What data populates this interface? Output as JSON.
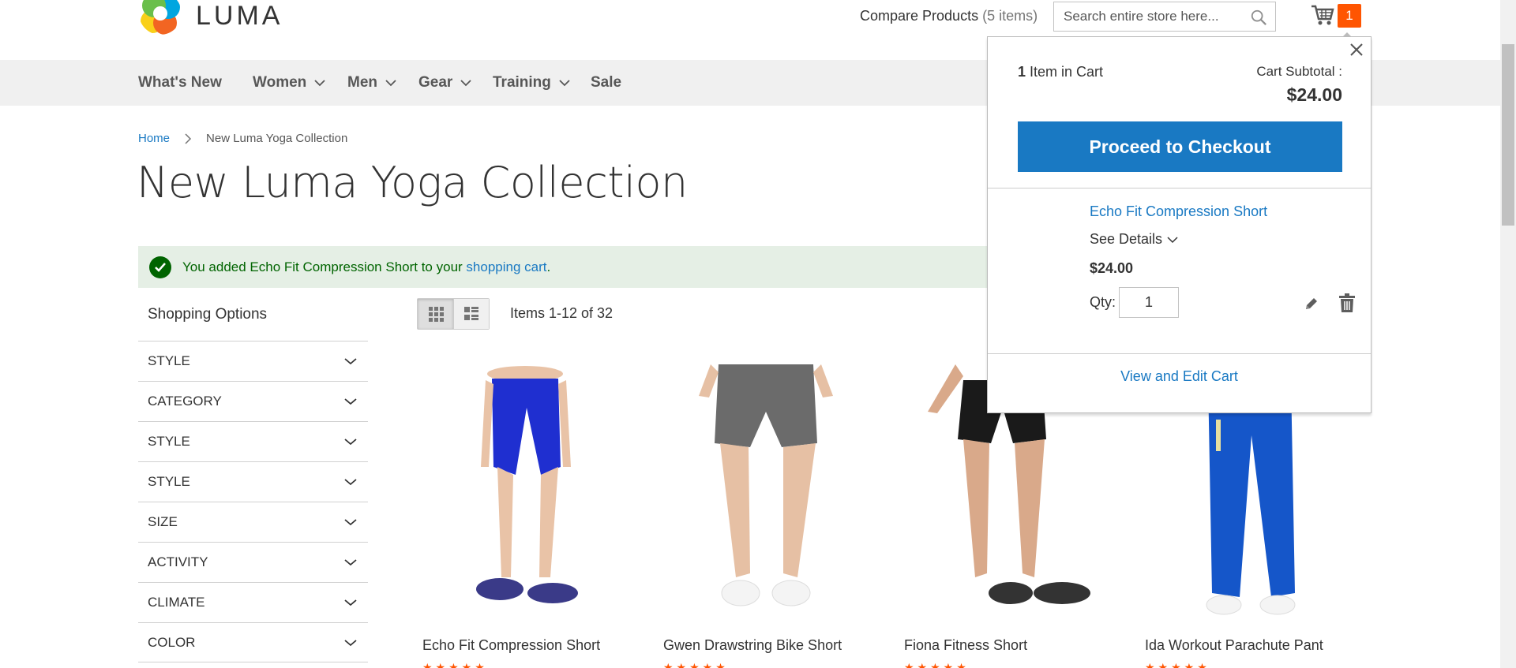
{
  "header": {
    "logo_text": "LUMA",
    "compare_label": "Compare Products",
    "compare_count": "(5 items)",
    "search_placeholder": "Search entire store here...",
    "cart_count": "1"
  },
  "nav": {
    "items": [
      {
        "label": "What's New",
        "has_dropdown": false
      },
      {
        "label": "Women",
        "has_dropdown": true
      },
      {
        "label": "Men",
        "has_dropdown": true
      },
      {
        "label": "Gear",
        "has_dropdown": true
      },
      {
        "label": "Training",
        "has_dropdown": true
      },
      {
        "label": "Sale",
        "has_dropdown": false
      }
    ]
  },
  "breadcrumb": {
    "home": "Home",
    "current": "New Luma Yoga Collection"
  },
  "page_title": "New Luma Yoga Collection",
  "message": {
    "prefix": "You added Echo Fit Compression Short to your ",
    "link": "shopping cart",
    "suffix": "."
  },
  "sidebar": {
    "title": "Shopping Options",
    "filters": [
      "STYLE",
      "CATEGORY",
      "STYLE",
      "STYLE",
      "SIZE",
      "ACTIVITY",
      "CLIMATE",
      "COLOR"
    ]
  },
  "toolbar": {
    "items_count": "Items 1-12 of 32"
  },
  "products": [
    {
      "name": "Echo Fit Compression Short"
    },
    {
      "name": "Gwen Drawstring Bike Short"
    },
    {
      "name": "Fiona Fitness Short"
    },
    {
      "name": "Ida Workout Parachute Pant"
    }
  ],
  "minicart": {
    "count_num": "1",
    "count_text": "Item in Cart",
    "subtotal_label": "Cart Subtotal :",
    "subtotal": "$24.00",
    "checkout_label": "Proceed to Checkout",
    "item_name": "Echo Fit Compression Short",
    "see_details": "See Details",
    "item_price": "$24.00",
    "qty_label": "Qty:",
    "qty_value": "1",
    "view_cart": "View and Edit Cart"
  },
  "colors": {
    "accent_blue": "#1979c3",
    "badge_orange": "#ff5501",
    "success_green": "#006400",
    "success_bg": "#e5efe5",
    "nav_bg": "#f0f0f0"
  }
}
